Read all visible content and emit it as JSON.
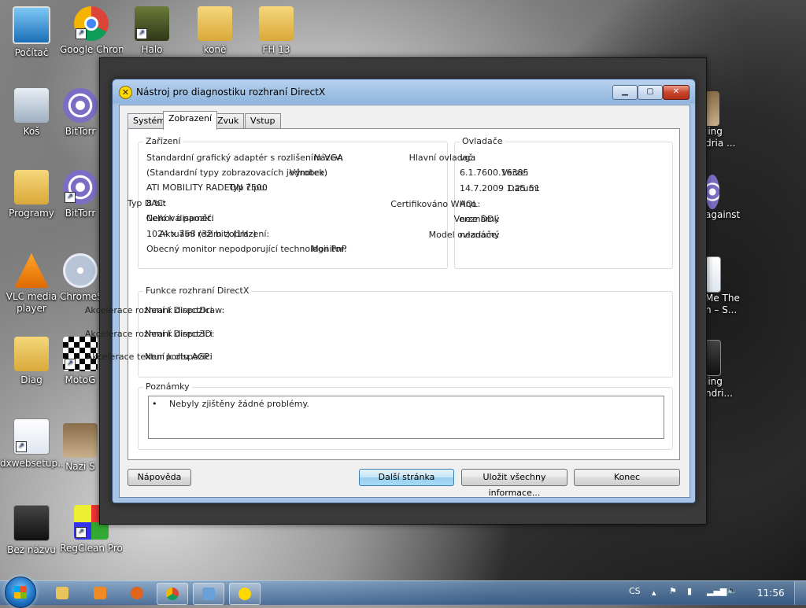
{
  "desktop_icons": [
    {
      "label": "Počítač"
    },
    {
      "label": "Google Chrom"
    },
    {
      "label": "Halo"
    },
    {
      "label": "koně"
    },
    {
      "label": "FH 13"
    },
    {
      "label": "Koš"
    },
    {
      "label": "BitTorr"
    },
    {
      "label": "Programy"
    },
    {
      "label": "BitTorr"
    },
    {
      "label": "VLC media player"
    },
    {
      "label": "ChromeS"
    },
    {
      "label": "Diag"
    },
    {
      "label": "MotoG"
    },
    {
      "label": "dxwebsetup...."
    },
    {
      "label": "Nazi S"
    },
    {
      "label": "Bez názvu"
    },
    {
      "label": "RegClean Pro"
    },
    {
      "label": "ling dria ..."
    },
    {
      "label": "against"
    },
    {
      "label": "Me The n – S..."
    },
    {
      "label": "ling ndri..."
    }
  ],
  "window": {
    "title": "Nástroj pro diagnostiku rozhraní DirectX",
    "controls": {
      "minimize": "▁",
      "maximize": "▢",
      "close": "✕"
    }
  },
  "tabs": [
    "Systém",
    "Zobrazení",
    "Zvuk",
    "Vstup"
  ],
  "device": {
    "group_title": "Zařízení",
    "rows": [
      {
        "label": "Název:",
        "value": "Standardní grafický adaptér s rozlišením VGA"
      },
      {
        "label": "Výrobce:",
        "value": "(Standardní typy zobrazovacích jednotek)"
      },
      {
        "label": "Typ čipu:",
        "value": "ATI MOBILITY RADEON 7500"
      },
      {
        "label": "Typ DAC:",
        "value": "8 bit"
      },
      {
        "label": "Celková paměť:",
        "value": "Není k dispozici"
      },
      {
        "label": "Aktuální režim zobrazení:",
        "value": "1024 x 768 (32 bit) (1Hz)"
      },
      {
        "label": "Monitor:",
        "value": "Obecný monitor nepodporující technologii PnP"
      }
    ]
  },
  "drivers": {
    "group_title": "Ovladače",
    "rows": [
      {
        "label": "Hlavní ovladač:",
        "value": "vga"
      },
      {
        "label": "Verze:",
        "value": "6.1.7600.16385"
      },
      {
        "label": "Datum:",
        "value": "14.7.2009 1:25:51"
      },
      {
        "label": "Certifikováno WHQL:",
        "value": "Ano"
      },
      {
        "label": "Verze DDI:",
        "value": "neznámý"
      },
      {
        "label": "Model ovladače:",
        "value": "neznámý"
      }
    ]
  },
  "directx": {
    "group_title": "Funkce rozhraní DirectX",
    "rows": [
      {
        "label": "Akcelerace rozhraní DirectDraw:",
        "value": "Není k dispozici"
      },
      {
        "label": "Akcelerace rozhraní Direct3D:",
        "value": "Není k dispozici"
      },
      {
        "label": "Akcelerace textur portu AGP:",
        "value": "Není k dispozici"
      }
    ]
  },
  "notes": {
    "group_title": "Poznámky",
    "bullet": "•",
    "text": "Nebyly zjištěny žádné problémy."
  },
  "buttons": {
    "help": "Nápověda",
    "next": "Další stránka",
    "save": "Uložit všechny informace...",
    "exit": "Konec"
  },
  "taskbar": {
    "items": [
      {
        "icon": "explorer-icon",
        "color": "#e8c45a"
      },
      {
        "icon": "media-player-icon",
        "color": "#f08a24"
      },
      {
        "icon": "firefox-icon",
        "color": "#e0641b"
      },
      {
        "icon": "chrome-icon",
        "color": "#4285f4"
      },
      {
        "icon": "paint-icon",
        "color": "#6aa0d8"
      },
      {
        "icon": "directx-icon",
        "color": "#ffd800"
      }
    ],
    "language": "CS",
    "clock": "11:56"
  }
}
